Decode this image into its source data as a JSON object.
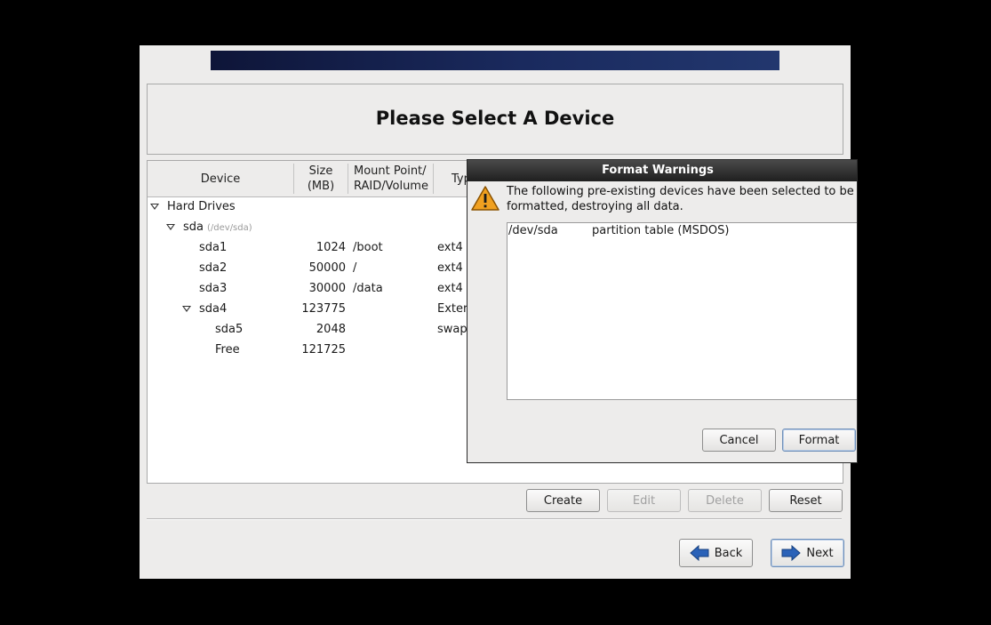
{
  "header": {
    "title": "Please Select A Device"
  },
  "tree": {
    "columns": {
      "device": "Device",
      "size": "Size\n(MB)",
      "mount": "Mount Point/\nRAID/Volume",
      "type": "Typ"
    },
    "rows": [
      {
        "name": "Hard Drives",
        "size": "",
        "mount": "",
        "type": "",
        "hint": ""
      },
      {
        "name": "sda",
        "size": "",
        "mount": "",
        "type": "",
        "hint": "(/dev/sda)"
      },
      {
        "name": "sda1",
        "size": "1024",
        "mount": "/boot",
        "type": "ext4",
        "hint": ""
      },
      {
        "name": "sda2",
        "size": "50000",
        "mount": "/",
        "type": "ext4",
        "hint": ""
      },
      {
        "name": "sda3",
        "size": "30000",
        "mount": "/data",
        "type": "ext4",
        "hint": ""
      },
      {
        "name": "sda4",
        "size": "123775",
        "mount": "",
        "type": "Exter",
        "hint": ""
      },
      {
        "name": "sda5",
        "size": "2048",
        "mount": "",
        "type": "swap",
        "hint": ""
      },
      {
        "name": "Free",
        "size": "121725",
        "mount": "",
        "type": "",
        "hint": ""
      }
    ]
  },
  "actions": {
    "create": "Create",
    "edit": "Edit",
    "delete": "Delete",
    "reset": "Reset"
  },
  "nav": {
    "back": "Back",
    "next": "Next"
  },
  "dialog": {
    "title": "Format Warnings",
    "message": "The following pre-existing devices have been selected to be formatted, destroying all data.",
    "items": [
      {
        "device": "/dev/sda",
        "description": "partition table (MSDOS)"
      }
    ],
    "cancel": "Cancel",
    "format": "Format"
  },
  "colors": {
    "banner": "#1a2a5e",
    "warning_icon": "#f0a020",
    "nav_arrow": "#2a62b8"
  },
  "icons": {
    "expander": "triangle-down-icon",
    "warning": "warning-icon",
    "back": "arrow-left-icon",
    "next": "arrow-right-icon"
  }
}
